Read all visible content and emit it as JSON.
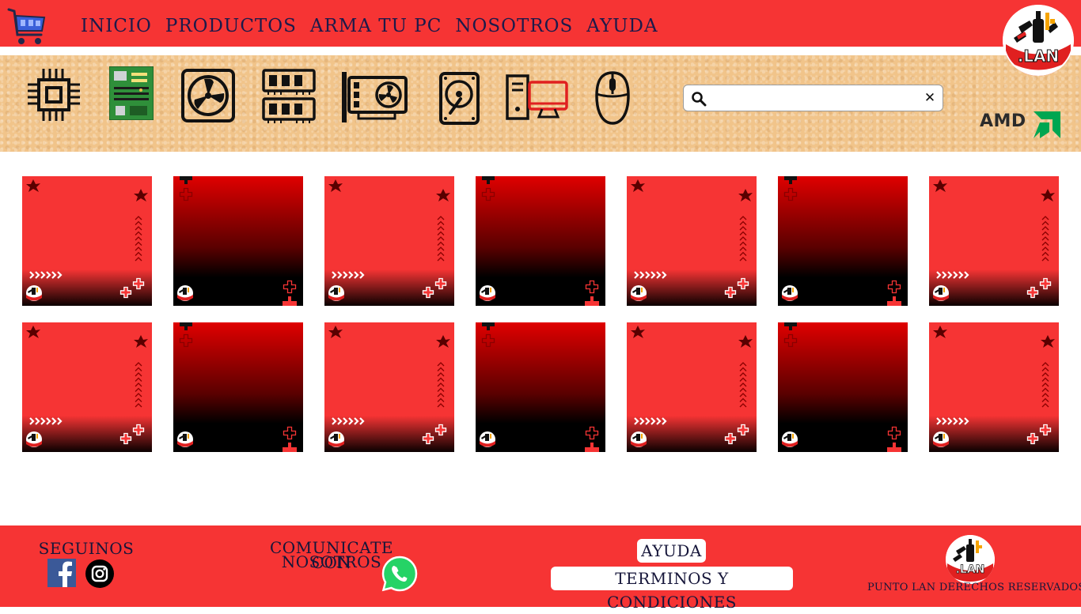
{
  "header": {
    "nav": [
      "INICIO",
      "PRODUCTOS",
      "ARMA TU PC",
      "NOSOTROS",
      "AYUDA"
    ],
    "logo_text": ".LAN",
    "icons": [
      "shopping-cart-icon",
      "brand-logo"
    ]
  },
  "toolbar": {
    "categories": [
      {
        "name": "cpu-icon"
      },
      {
        "name": "motherboard-icon"
      },
      {
        "name": "power-supply-icon"
      },
      {
        "name": "ram-icon"
      },
      {
        "name": "graphics-card-icon"
      },
      {
        "name": "hard-drive-icon"
      },
      {
        "name": "desktop-pc-icon"
      },
      {
        "name": "mouse-icon"
      }
    ],
    "search": {
      "value": "",
      "placeholder": "",
      "clear_symbol": "✕"
    },
    "brand": "AMD"
  },
  "products": {
    "rows": 2,
    "columns": 7
  },
  "footer": {
    "follow_title": "SEGUINOS",
    "contact_title_1": "COMUNICATE CON",
    "contact_title_2": "NOSOTROS",
    "help_button": "AYUDA",
    "terms_button": "TERMINOS Y CONDICIONES",
    "rights": "PUNTO LAN DERECHOS RESERVADOS",
    "logo_text": ".LAN"
  },
  "colors": {
    "primary_red": "#f63434",
    "nav_text": "#1d1a4a",
    "toolbar_bg": "#f1c48a",
    "whatsapp": "#25d366",
    "facebook": "#3b5998",
    "amd_green": "#00a651"
  }
}
